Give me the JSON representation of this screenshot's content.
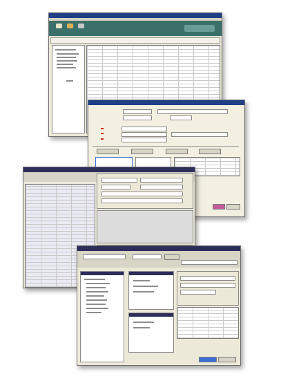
{
  "windows": [
    {
      "name": "main-list-window",
      "accent": "#1f3f86"
    },
    {
      "name": "detail-form-window",
      "accent": "#1f3f86"
    },
    {
      "name": "spreadsheet-window",
      "accent": "#2d2d5a"
    },
    {
      "name": "record-tree-window",
      "accent": "#2d2d5a"
    }
  ],
  "colors": {
    "background": "#ffffff",
    "window": "#ece9d8",
    "highlight": "#c85a9a",
    "select": "#3d6fd8"
  }
}
